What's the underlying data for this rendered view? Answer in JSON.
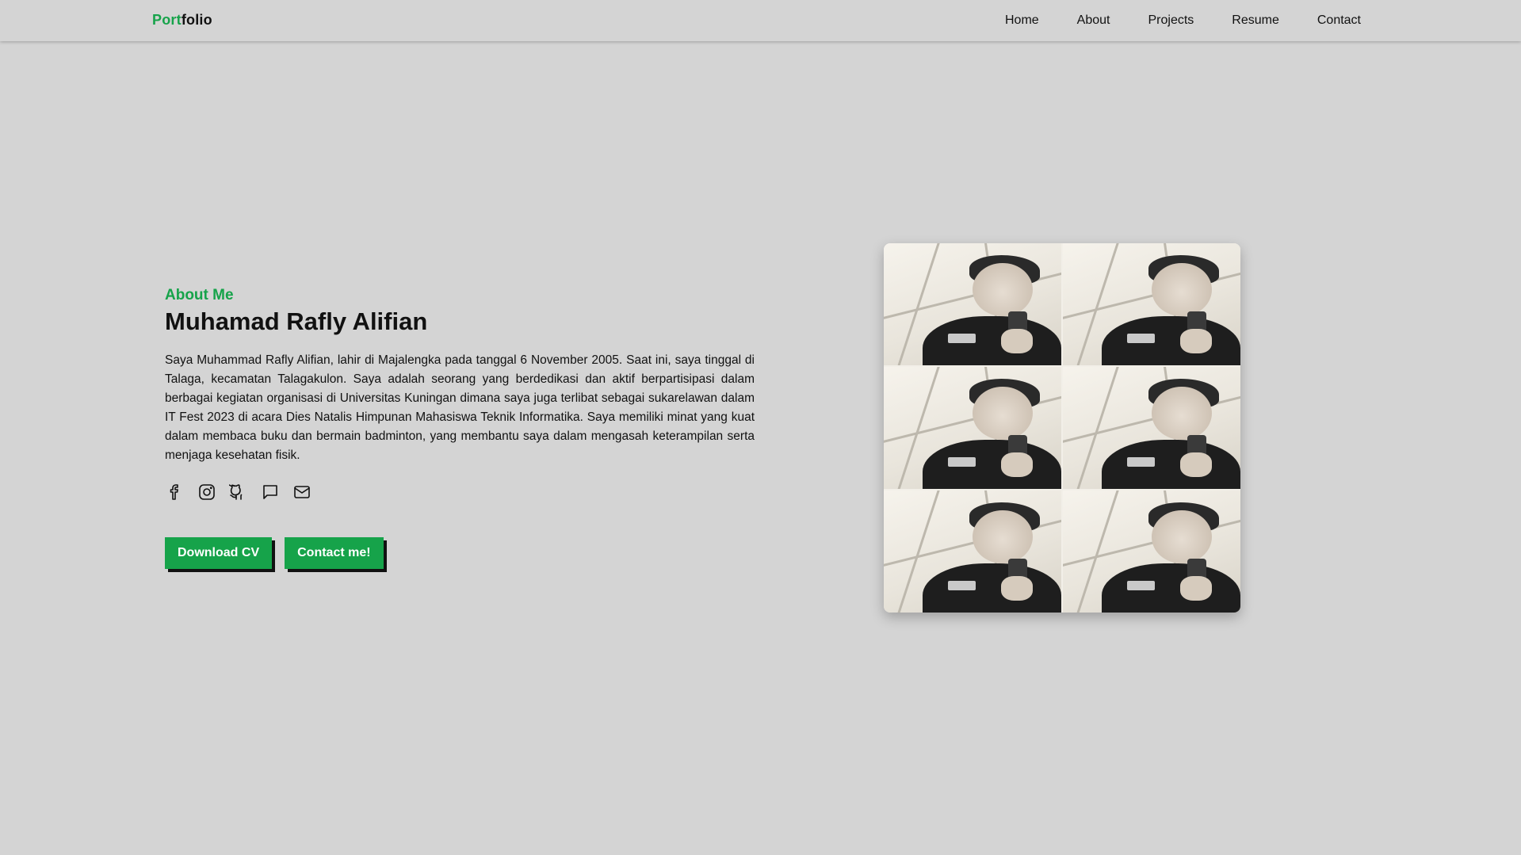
{
  "brand": {
    "accent": "Port",
    "rest": "folio"
  },
  "nav": {
    "items": [
      {
        "label": "Home"
      },
      {
        "label": "About"
      },
      {
        "label": "Projects"
      },
      {
        "label": "Resume"
      },
      {
        "label": "Contact"
      }
    ]
  },
  "hero": {
    "eyebrow": "About Me",
    "name": "Muhamad Rafly Alifian",
    "bio": "Saya Muhammad Rafly Alifian, lahir di Majalengka pada tanggal 6 November 2005. Saat ini, saya tinggal di Talaga, kecamatan Talagakulon. Saya adalah seorang yang berdedikasi dan aktif berpartisipasi dalam berbagai kegiatan organisasi di Universitas Kuningan dimana saya juga terlibat sebagai sukarelawan dalam IT Fest 2023 di acara Dies Natalis Himpunan Mahasiswa Teknik Informatika. Saya memiliki minat yang kuat dalam membaca buku dan bermain badminton, yang membantu saya dalam mengasah keterampilan serta menjaga kesehatan fisik.",
    "socials": [
      {
        "icon": "facebook-icon"
      },
      {
        "icon": "instagram-icon"
      },
      {
        "icon": "github-icon"
      },
      {
        "icon": "chat-icon"
      },
      {
        "icon": "mail-icon"
      }
    ],
    "buttons": {
      "download": "Download CV",
      "contact": "Contact me!"
    }
  },
  "photo": {
    "tiles": 6
  },
  "colors": {
    "accent": "#16a34a",
    "background": "#d4d4d4",
    "text": "#111111"
  }
}
